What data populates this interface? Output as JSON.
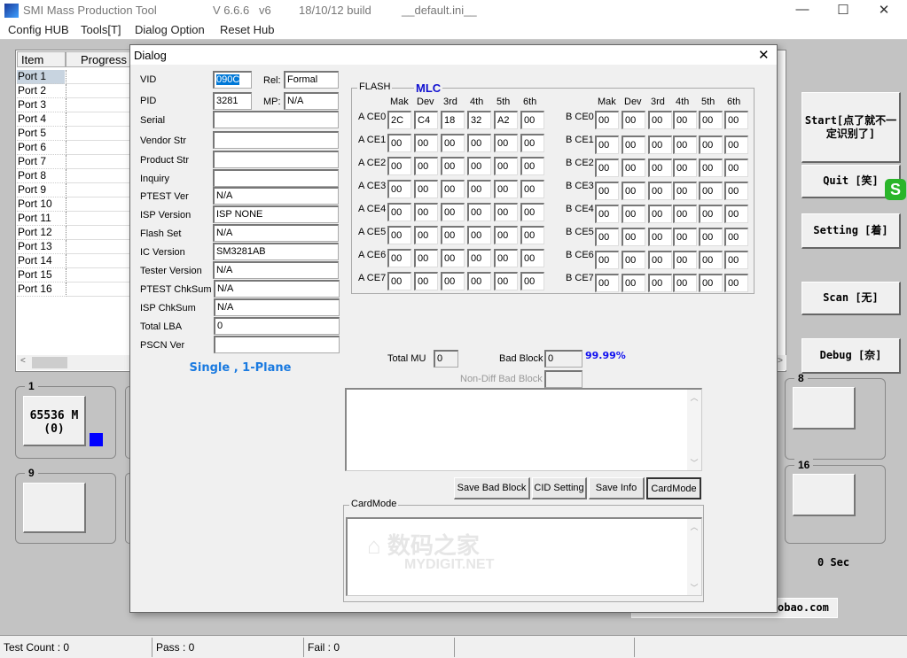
{
  "titlebar": {
    "app": "SMI Mass Production Tool",
    "version": "V 6.6.6   v6",
    "build": "18/10/12 build",
    "ini": "__default.ini__",
    "minimize": "—",
    "maximize": "☐",
    "close": "✕"
  },
  "menu": [
    "Config HUB",
    "Tools[T]",
    "Dialog Option",
    "Reset Hub"
  ],
  "portlist": {
    "headers": [
      "Item",
      "Progress"
    ],
    "ports": [
      "Port 1",
      "Port 2",
      "Port 3",
      "Port 4",
      "Port 5",
      "Port 6",
      "Port 7",
      "Port 8",
      "Port 9",
      "Port 10",
      "Port 11",
      "Port 12",
      "Port 13",
      "Port 14",
      "Port 15",
      "Port 16"
    ]
  },
  "groups": {
    "g1": {
      "label": "1",
      "slot_line1": "65536 M",
      "slot_line2": "(0)",
      "indicator_color": "#0000ff"
    },
    "g9": {
      "label": "9"
    },
    "g8": {
      "label": "8"
    },
    "g16": {
      "label": "16"
    }
  },
  "right_buttons": {
    "start": "Start[点了就不一定识别了]",
    "quit": "Quit  [笑]",
    "setting": "Setting [着]",
    "scan": "Scan  [无]",
    "debug": "Debug  [奈]"
  },
  "timer": "0 Sec",
  "taobao": "obao.com",
  "statusbar": [
    "Test Count : 0",
    "Pass : 0",
    "Fail : 0",
    "",
    ""
  ],
  "dialog": {
    "title": "Dialog",
    "close": "✕",
    "vid": {
      "label": "VID",
      "value": "090C"
    },
    "rel": {
      "label": "Rel:",
      "value": "Formal"
    },
    "pid": {
      "label": "PID",
      "value": "3281"
    },
    "mp": {
      "label": "MP:",
      "value": "N/A"
    },
    "fields": [
      {
        "label": "Serial",
        "value": ""
      },
      {
        "label": "Vendor Str",
        "value": ""
      },
      {
        "label": "Product Str",
        "value": ""
      },
      {
        "label": "Inquiry",
        "value": ""
      },
      {
        "label": "PTEST Ver",
        "value": "N/A"
      },
      {
        "label": "ISP Version",
        "value": "ISP NONE"
      },
      {
        "label": "Flash Set",
        "value": "N/A"
      },
      {
        "label": "IC Version",
        "value": "SM3281AB"
      },
      {
        "label": "Tester Version",
        "value": "N/A"
      },
      {
        "label": "PTEST ChkSum",
        "value": "N/A"
      },
      {
        "label": "ISP ChkSum",
        "value": "N/A"
      },
      {
        "label": "Total LBA",
        "value": "0"
      },
      {
        "label": "PSCN Ver",
        "value": ""
      }
    ],
    "plane": "Single , 1-Plane",
    "flash": {
      "legend": "FLASH",
      "type": "MLC",
      "columns": [
        "Mak",
        "Dev",
        "3rd",
        "4th",
        "5th",
        "6th"
      ],
      "a_rows": [
        {
          "label": "A CE0",
          "values": [
            "2C",
            "C4",
            "18",
            "32",
            "A2",
            "00"
          ]
        },
        {
          "label": "A CE1",
          "values": [
            "00",
            "00",
            "00",
            "00",
            "00",
            "00"
          ]
        },
        {
          "label": "A CE2",
          "values": [
            "00",
            "00",
            "00",
            "00",
            "00",
            "00"
          ]
        },
        {
          "label": "A CE3",
          "values": [
            "00",
            "00",
            "00",
            "00",
            "00",
            "00"
          ]
        },
        {
          "label": "A CE4",
          "values": [
            "00",
            "00",
            "00",
            "00",
            "00",
            "00"
          ]
        },
        {
          "label": "A CE5",
          "values": [
            "00",
            "00",
            "00",
            "00",
            "00",
            "00"
          ]
        },
        {
          "label": "A CE6",
          "values": [
            "00",
            "00",
            "00",
            "00",
            "00",
            "00"
          ]
        },
        {
          "label": "A CE7",
          "values": [
            "00",
            "00",
            "00",
            "00",
            "00",
            "00"
          ]
        }
      ],
      "b_rows": [
        {
          "label": "B CE0",
          "values": [
            "00",
            "00",
            "00",
            "00",
            "00",
            "00"
          ]
        },
        {
          "label": "B CE1",
          "values": [
            "00",
            "00",
            "00",
            "00",
            "00",
            "00"
          ]
        },
        {
          "label": "B CE2",
          "values": [
            "00",
            "00",
            "00",
            "00",
            "00",
            "00"
          ]
        },
        {
          "label": "B CE3",
          "values": [
            "00",
            "00",
            "00",
            "00",
            "00",
            "00"
          ]
        },
        {
          "label": "B CE4",
          "values": [
            "00",
            "00",
            "00",
            "00",
            "00",
            "00"
          ]
        },
        {
          "label": "B CE5",
          "values": [
            "00",
            "00",
            "00",
            "00",
            "00",
            "00"
          ]
        },
        {
          "label": "B CE6",
          "values": [
            "00",
            "00",
            "00",
            "00",
            "00",
            "00"
          ]
        },
        {
          "label": "B CE7",
          "values": [
            "00",
            "00",
            "00",
            "00",
            "00",
            "00"
          ]
        }
      ]
    },
    "total_mu": {
      "label": "Total MU",
      "value": "0"
    },
    "bad_block": {
      "label": "Bad Block",
      "value": "0",
      "percent": "99.99%"
    },
    "non_diff": {
      "label": "Non-Diff Bad Block",
      "value": ""
    },
    "buttons": [
      "Save Bad Block",
      "CID Setting",
      "Save Info",
      "CardMode"
    ],
    "cardmode_legend": "CardMode",
    "watermark": "数码之家 MYDIGIT.NET"
  }
}
